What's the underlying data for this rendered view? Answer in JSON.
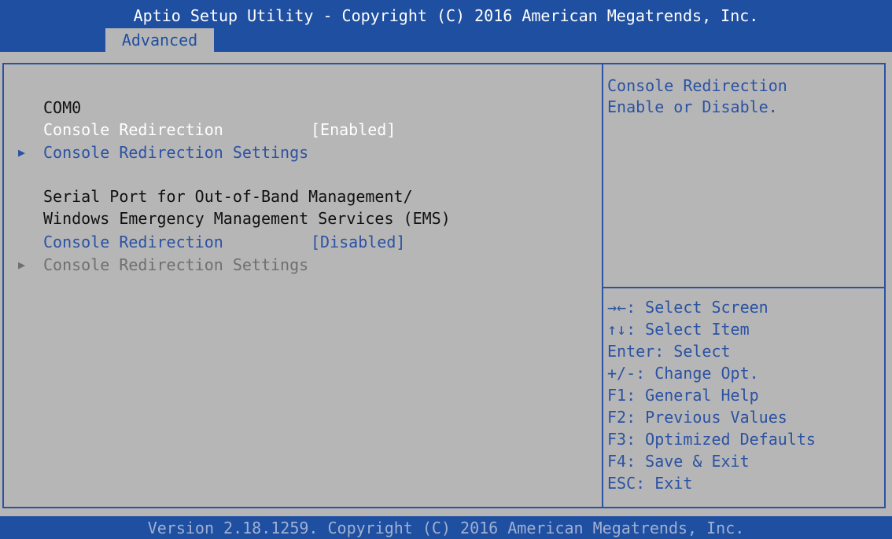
{
  "header": {
    "title": "Aptio Setup Utility - Copyright (C) 2016 American Megatrends, Inc.",
    "active_tab": "Advanced"
  },
  "settings": {
    "section1_title": "COM0",
    "item1": {
      "label": "Console Redirection",
      "value": "[Enabled]"
    },
    "item2": {
      "label": "Console Redirection Settings",
      "arrow": "▶"
    },
    "section2_line1": "Serial Port for Out-of-Band Management/",
    "section2_line2": "Windows Emergency Management Services (EMS)",
    "item3": {
      "label": "Console Redirection",
      "value": "[Disabled]"
    },
    "item4": {
      "label": "Console Redirection Settings",
      "arrow": "▶"
    }
  },
  "help": {
    "line1": "Console Redirection",
    "line2": "Enable or Disable."
  },
  "keys": [
    "→←: Select Screen",
    "↑↓: Select Item",
    "Enter: Select",
    "+/-: Change Opt.",
    "F1: General Help",
    "F2: Previous Values",
    "F3: Optimized Defaults",
    "F4: Save & Exit",
    "ESC: Exit"
  ],
  "footer": {
    "text": "Version 2.18.1259. Copyright (C) 2016 American Megatrends, Inc."
  },
  "colors": {
    "header_bg": "#1f4fa0",
    "panel_bg": "#b6b6b6",
    "highlight_text": "#ffffff",
    "selectable_text": "#2b52a3",
    "disabled_text": "#6f6f6f"
  }
}
